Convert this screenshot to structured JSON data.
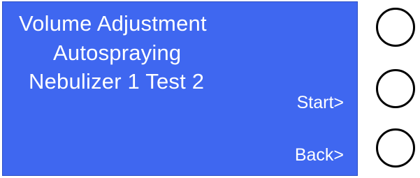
{
  "display": {
    "lines": [
      "Volume Adjustment",
      "Autospraying",
      "Nebulizer 1 Test 2"
    ],
    "softkeys": {
      "start": "Start>",
      "back": "Back>"
    },
    "background_color": "#3f67f0",
    "text_color": "#ffffff"
  },
  "hardware_buttons": [
    {
      "name": "top",
      "label": ""
    },
    {
      "name": "middle",
      "label": ""
    },
    {
      "name": "bottom",
      "label": ""
    }
  ]
}
